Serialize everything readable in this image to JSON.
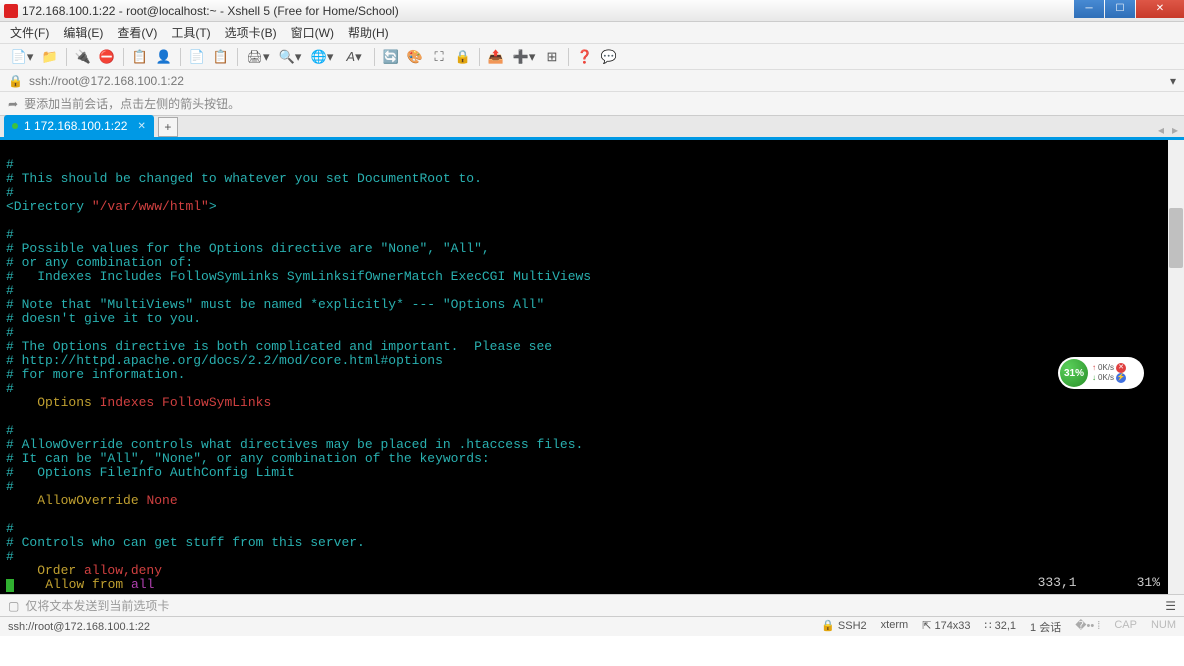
{
  "title": "172.168.100.1:22 - root@localhost:~ - Xshell 5 (Free for Home/School)",
  "menu": [
    "文件(F)",
    "编辑(E)",
    "查看(V)",
    "工具(T)",
    "选项卡(B)",
    "窗口(W)",
    "帮助(H)"
  ],
  "address": "ssh://root@172.168.100.1:22",
  "tip": "要添加当前会话，点击左侧的箭头按钮。",
  "tab": {
    "label": "1 172.168.100.1:22"
  },
  "terminal": {
    "lines": [
      {
        "segs": [
          {
            "t": "#",
            "c": "teal"
          }
        ]
      },
      {
        "segs": [
          {
            "t": "# This should be changed to whatever you set DocumentRoot to.",
            "c": "teal"
          }
        ]
      },
      {
        "segs": [
          {
            "t": "#",
            "c": "teal"
          }
        ]
      },
      {
        "segs": [
          {
            "t": "<Directory ",
            "c": "teal"
          },
          {
            "t": "\"/var/www/html\"",
            "c": "red"
          },
          {
            "t": ">",
            "c": "teal"
          }
        ]
      },
      {
        "segs": []
      },
      {
        "segs": [
          {
            "t": "#",
            "c": "teal"
          }
        ]
      },
      {
        "segs": [
          {
            "t": "# Possible values for the Options directive are \"None\", \"All\",",
            "c": "teal"
          }
        ]
      },
      {
        "segs": [
          {
            "t": "# or any combination of:",
            "c": "teal"
          }
        ]
      },
      {
        "segs": [
          {
            "t": "#   Indexes Includes FollowSymLinks SymLinksifOwnerMatch ExecCGI MultiViews",
            "c": "teal"
          }
        ]
      },
      {
        "segs": [
          {
            "t": "#",
            "c": "teal"
          }
        ]
      },
      {
        "segs": [
          {
            "t": "# Note that \"MultiViews\" must be named *explicitly* --- \"Options All\"",
            "c": "teal"
          }
        ]
      },
      {
        "segs": [
          {
            "t": "# doesn't give it to you.",
            "c": "teal"
          }
        ]
      },
      {
        "segs": [
          {
            "t": "#",
            "c": "teal"
          }
        ]
      },
      {
        "segs": [
          {
            "t": "# The Options directive is both complicated and important.  Please see",
            "c": "teal"
          }
        ]
      },
      {
        "segs": [
          {
            "t": "# http://httpd.apache.org/docs/2.2/mod/core.html#options",
            "c": "teal"
          }
        ]
      },
      {
        "segs": [
          {
            "t": "# for more information.",
            "c": "teal"
          }
        ]
      },
      {
        "segs": [
          {
            "t": "#",
            "c": "teal"
          }
        ]
      },
      {
        "segs": [
          {
            "t": "    Options ",
            "c": "yellow"
          },
          {
            "t": "Indexes FollowSymLinks",
            "c": "red"
          }
        ]
      },
      {
        "segs": []
      },
      {
        "segs": [
          {
            "t": "#",
            "c": "teal"
          }
        ]
      },
      {
        "segs": [
          {
            "t": "# AllowOverride controls what directives may be placed in .htaccess files.",
            "c": "teal"
          }
        ]
      },
      {
        "segs": [
          {
            "t": "# It can be \"All\", \"None\", or any combination of the keywords:",
            "c": "teal"
          }
        ]
      },
      {
        "segs": [
          {
            "t": "#   Options FileInfo AuthConfig Limit",
            "c": "teal"
          }
        ]
      },
      {
        "segs": [
          {
            "t": "#",
            "c": "teal"
          }
        ]
      },
      {
        "segs": [
          {
            "t": "    AllowOverride ",
            "c": "yellow"
          },
          {
            "t": "None",
            "c": "red"
          }
        ]
      },
      {
        "segs": []
      },
      {
        "segs": [
          {
            "t": "#",
            "c": "teal"
          }
        ]
      },
      {
        "segs": [
          {
            "t": "# Controls who can get stuff from this server.",
            "c": "teal"
          }
        ]
      },
      {
        "segs": [
          {
            "t": "#",
            "c": "teal"
          }
        ]
      },
      {
        "segs": [
          {
            "t": "    Order ",
            "c": "yellow"
          },
          {
            "t": "allow,deny",
            "c": "red"
          }
        ]
      },
      {
        "segs": [
          {
            "t": "    Allow from ",
            "c": "yellow"
          },
          {
            "t": "all",
            "c": "magenta"
          }
        ],
        "cursor": true
      }
    ],
    "pos": "333,1",
    "percent": "31%"
  },
  "inputbar_placeholder": "仅将文本发送到当前选项卡",
  "status": {
    "left": "ssh://root@172.168.100.1:22",
    "ssh": "SSH2",
    "term": "xterm",
    "size": "174x33",
    "cursor": "32,1",
    "sessions": "1 会话",
    "cap": "CAP",
    "num": "NUM"
  },
  "widget": {
    "pct": "31%",
    "up": "0K/s",
    "down": "0K/s"
  }
}
